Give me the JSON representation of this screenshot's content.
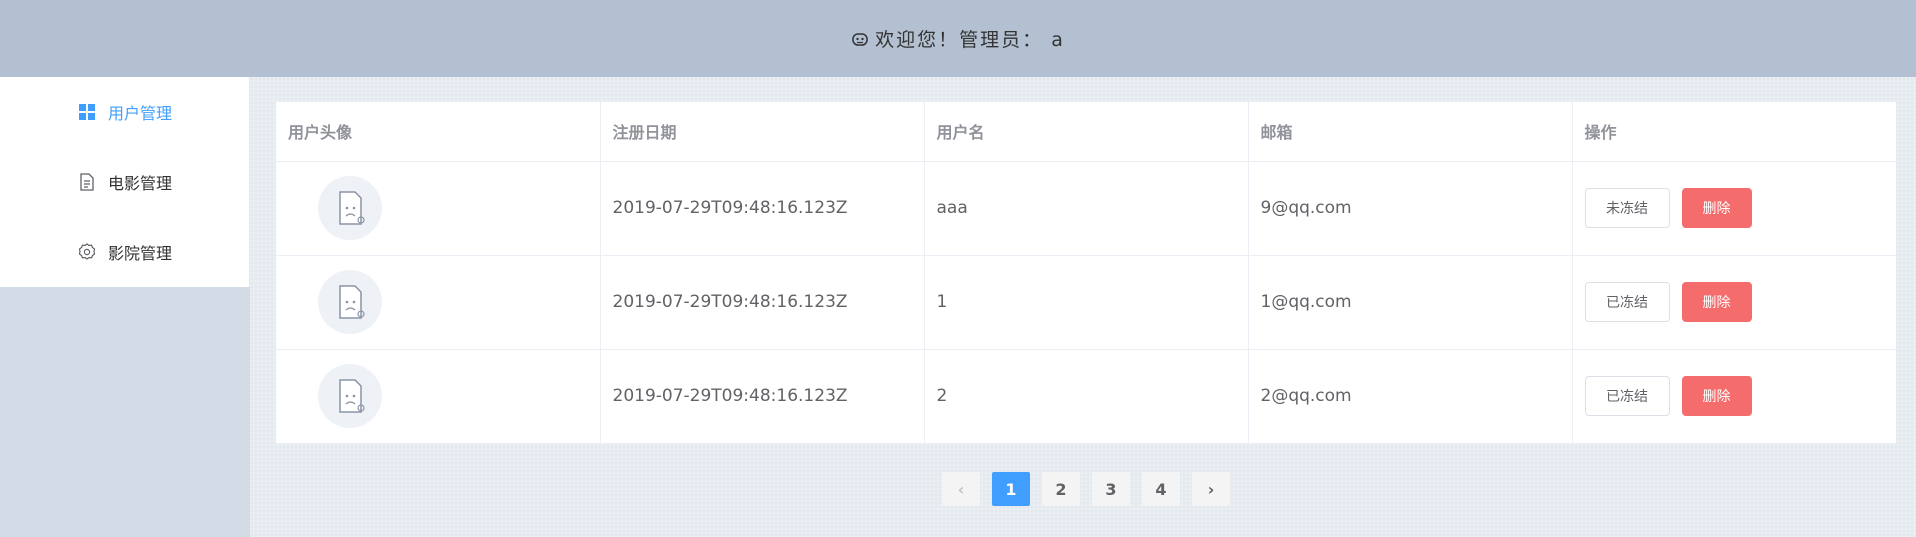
{
  "header": {
    "welcome": "欢迎您！管理员： a"
  },
  "menu": {
    "items": [
      {
        "label": "用户管理",
        "icon": "grid-icon",
        "active": true
      },
      {
        "label": "电影管理",
        "icon": "document-icon",
        "active": false
      },
      {
        "label": "影院管理",
        "icon": "gear-icon",
        "active": false
      }
    ]
  },
  "table": {
    "columns": [
      "用户头像",
      "注册日期",
      "用户名",
      "邮箱",
      "操作"
    ],
    "rows": [
      {
        "date": "2019-07-29T09:48:16.123Z",
        "username": "aaa",
        "email": "9@qq.com",
        "status": "未冻结",
        "delete": "删除"
      },
      {
        "date": "2019-07-29T09:48:16.123Z",
        "username": "1",
        "email": "1@qq.com",
        "status": "已冻结",
        "delete": "删除"
      },
      {
        "date": "2019-07-29T09:48:16.123Z",
        "username": "2",
        "email": "2@qq.com",
        "status": "已冻结",
        "delete": "删除"
      }
    ]
  },
  "pagination": {
    "prev": "‹",
    "next": "›",
    "pages": [
      "1",
      "2",
      "3",
      "4"
    ],
    "current": "1"
  },
  "colors": {
    "header": "#b3c0d1",
    "accent": "#409eff",
    "danger": "#f56c6c"
  }
}
